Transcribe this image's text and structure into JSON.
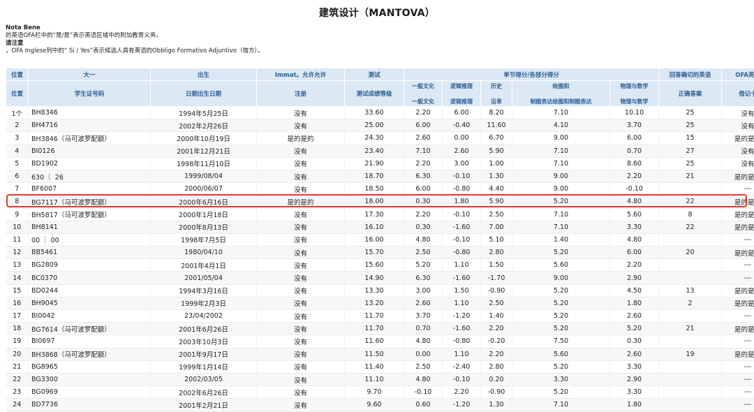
{
  "title": "建筑设计（MANTOVA）",
  "notes": {
    "nota_bene": "Nota Bene",
    "line1": "的英语OFA栏中的“是/是”表示英语区域中的附加教育义务。",
    "heading": "请注意",
    "line2": "，OFA Inglese列中的“ Si / Yes”表示候选人具有英语的Obbligo Formativo Adjuntivo（借方）。"
  },
  "headers": {
    "pos_top": "位置",
    "pos_bottom": "位置",
    "student_top": "大一",
    "student_bottom": "学生证号码",
    "birth_top": "出生",
    "birth_bottom": "日期出生日期",
    "immat_top": "Immat。允许允许",
    "immat_bottom": "注册",
    "test_top": "测试",
    "test_bottom": "测试成绩等级",
    "group": "单节得分/各部分得分",
    "gc_top": "一般文化",
    "gc_bottom": "一般文化",
    "lr_top": "逻辑推理",
    "lr_bottom": "逻辑推理",
    "hist_top": "历史",
    "hist_bottom": "沿革",
    "draw_top": "绘图和",
    "draw_bottom": "制图表达绘图和制图表达",
    "phys_top": "物理与数学",
    "phys_bottom": "物理与数学",
    "eng_top": "回答确切的英语",
    "eng_bottom": "正确答案",
    "ofa_top": "OFA英语",
    "ofa_bottom": "借记卡"
  },
  "rows": [
    {
      "pos": "1个",
      "id": "BH8346",
      "birth": "1994年5月25日",
      "immat": "没有",
      "score": "33.60",
      "gc": "2.20",
      "lr": "6.00",
      "hist": "8.20",
      "draw": "7.10",
      "phys": "10.10",
      "eng": "25",
      "ofa": "没有"
    },
    {
      "pos": "2",
      "id": "BH4716",
      "birth": "2002年2月26日",
      "immat": "没有",
      "score": "25.00",
      "gc": "6.00",
      "lr": "-0.40",
      "hist": "11.60",
      "draw": "4.10",
      "phys": "3.70",
      "eng": "25",
      "ofa": "没有"
    },
    {
      "pos": "3",
      "id": "BH3846（马可波罗配额）",
      "birth": "2000年10月19日",
      "immat": "是的是的",
      "score": "24.30",
      "gc": "2.60",
      "lr": "0.00",
      "hist": "6.70",
      "draw": "9.00",
      "phys": "6.00",
      "eng": "15",
      "ofa": "是的是的"
    },
    {
      "pos": "4",
      "id": "BI0126",
      "birth": "2001年12月21日",
      "immat": "没有",
      "score": "23.40",
      "gc": "7.10",
      "lr": "2.60",
      "hist": "5.90",
      "draw": "7.10",
      "phys": "0.70",
      "eng": "27",
      "ofa": "没有"
    },
    {
      "pos": "5",
      "id": "BD1902",
      "birth": "1998年11月10日",
      "immat": "没有",
      "score": "21.90",
      "gc": "2.20",
      "lr": "3.00",
      "hist": "1.00",
      "draw": "7.10",
      "phys": "8.60",
      "eng": "25",
      "ofa": "没有"
    },
    {
      "pos": "6",
      "id": "630 ｜ 26",
      "birth": "1999/08/04",
      "immat": "没有",
      "score": "18.70",
      "gc": "6.30",
      "lr": "-0.10",
      "hist": "1.30",
      "draw": "9.00",
      "phys": "2.20",
      "eng": "21",
      "ofa": "是的是的"
    },
    {
      "pos": "7",
      "id": "BF6007",
      "birth": "2000/06/07",
      "immat": "没有",
      "score": "18.50",
      "gc": "6.00",
      "lr": "-0.80",
      "hist": "4.40",
      "draw": "9.00",
      "phys": "-0.10",
      "eng": "",
      "ofa": "---"
    },
    {
      "pos": "8",
      "id": "BG7117（马可波罗配额）",
      "birth": "2000年6月16日",
      "immat": "是的是的",
      "score": "18.00",
      "gc": "0.30",
      "lr": "1.80",
      "hist": "5.90",
      "draw": "5.20",
      "phys": "4.80",
      "eng": "22",
      "ofa": "是的是的"
    },
    {
      "pos": "9",
      "id": "BH5817（马可波罗配额）",
      "birth": "2000年1月18日",
      "immat": "没有",
      "score": "17.30",
      "gc": "2.20",
      "lr": "-0.10",
      "hist": "2.50",
      "draw": "7.10",
      "phys": "5.60",
      "eng": "8",
      "ofa": "是的是的"
    },
    {
      "pos": "10",
      "id": "BH8141",
      "birth": "2000年8月13日",
      "immat": "没有",
      "score": "16.10",
      "gc": "0.30",
      "lr": "-1.60",
      "hist": "7.00",
      "draw": "7.10",
      "phys": "3.30",
      "eng": "22",
      "ofa": "是的是的"
    },
    {
      "pos": "11",
      "id": "00 ｜ 00",
      "birth": "1998年7月5日",
      "immat": "没有",
      "score": "16.00",
      "gc": "4.80",
      "lr": "-0.10",
      "hist": "5.10",
      "draw": "1.40",
      "phys": "4.80",
      "eng": "",
      "ofa": "---"
    },
    {
      "pos": "12",
      "id": "BB5461",
      "birth": "1980/04/10",
      "immat": "没有",
      "score": "15.70",
      "gc": "2.50",
      "lr": "-0.80",
      "hist": "2.80",
      "draw": "5.20",
      "phys": "6.00",
      "eng": "20",
      "ofa": "是的是的"
    },
    {
      "pos": "13",
      "id": "BG2809",
      "birth": "2001年4月1日",
      "immat": "没有",
      "score": "15.60",
      "gc": "5.20",
      "lr": "1.10",
      "hist": "1.50",
      "draw": "5.60",
      "phys": "2.20",
      "eng": "",
      "ofa": "---"
    },
    {
      "pos": "14",
      "id": "BC0370",
      "birth": "2001/05/04",
      "immat": "没有",
      "score": "14.90",
      "gc": "6.30",
      "lr": "-1.60",
      "hist": "-1.70",
      "draw": "9.00",
      "phys": "2.90",
      "eng": "",
      "ofa": "---"
    },
    {
      "pos": "15",
      "id": "BD0244",
      "birth": "1994年3月16日",
      "immat": "没有",
      "score": "13.30",
      "gc": "3.00",
      "lr": "1.50",
      "hist": "-0.90",
      "draw": "5.20",
      "phys": "4.50",
      "eng": "13",
      "ofa": "是的是的"
    },
    {
      "pos": "16",
      "id": "BH9045",
      "birth": "1999年2月3日",
      "immat": "没有",
      "score": "13.20",
      "gc": "2.60",
      "lr": "1.10",
      "hist": "2.50",
      "draw": "5.20",
      "phys": "1.80",
      "eng": "2",
      "ofa": "是的是的"
    },
    {
      "pos": "17",
      "id": "BI0042",
      "birth": "23/04/2002",
      "immat": "没有",
      "score": "11.70",
      "gc": "3.70",
      "lr": "-1.20",
      "hist": "1.40",
      "draw": "5.20",
      "phys": "2.60",
      "eng": "",
      "ofa": "---"
    },
    {
      "pos": "18",
      "id": "BG7614（马可波罗配额）",
      "birth": "2001年6月26日",
      "immat": "没有",
      "score": "11.70",
      "gc": "0.70",
      "lr": "-1.60",
      "hist": "2.20",
      "draw": "5.20",
      "phys": "5.20",
      "eng": "21",
      "ofa": "是的是的"
    },
    {
      "pos": "19",
      "id": "BI0697",
      "birth": "2003年10月3日",
      "immat": "没有",
      "score": "11.60",
      "gc": "4.80",
      "lr": "-0.80",
      "hist": "-0.20",
      "draw": "7.50",
      "phys": "0.30",
      "eng": "",
      "ofa": "---"
    },
    {
      "pos": "20",
      "id": "BH3868（马可波罗配额）",
      "birth": "2001年9月17日",
      "immat": "没有",
      "score": "11.50",
      "gc": "0.00",
      "lr": "1.10",
      "hist": "2.20",
      "draw": "5.60",
      "phys": "2.60",
      "eng": "19",
      "ofa": "是的是的"
    },
    {
      "pos": "21",
      "id": "BG8965",
      "birth": "1999年1月14日",
      "immat": "没有",
      "score": "11.40",
      "gc": "2.50",
      "lr": "-2.40",
      "hist": "2.80",
      "draw": "5.20",
      "phys": "3.30",
      "eng": "",
      "ofa": "---"
    },
    {
      "pos": "22",
      "id": "BG3300",
      "birth": "2002/03/05",
      "immat": "没有",
      "score": "11.10",
      "gc": "4.80",
      "lr": "-0.10",
      "hist": "0.20",
      "draw": "3.30",
      "phys": "2.90",
      "eng": "",
      "ofa": "---"
    },
    {
      "pos": "23",
      "id": "BG0969",
      "birth": "2002年6月26日",
      "immat": "没有",
      "score": "9.70",
      "gc": "-0.10",
      "lr": "2.20",
      "hist": "-0.90",
      "draw": "5.20",
      "phys": "3.30",
      "eng": "",
      "ofa": "---"
    },
    {
      "pos": "24",
      "id": "BD7736",
      "birth": "2001年2月21日",
      "immat": "没有",
      "score": "9.60",
      "gc": "0.60",
      "lr": "-1.20",
      "hist": "1.30",
      "draw": "7.10",
      "phys": "1.80",
      "eng": "",
      "ofa": "---"
    }
  ],
  "highlighted_row": "8",
  "highlight_color": "#e33b2c",
  "header_bg": "#dce8f4",
  "header_text_color": "#2d5f95"
}
